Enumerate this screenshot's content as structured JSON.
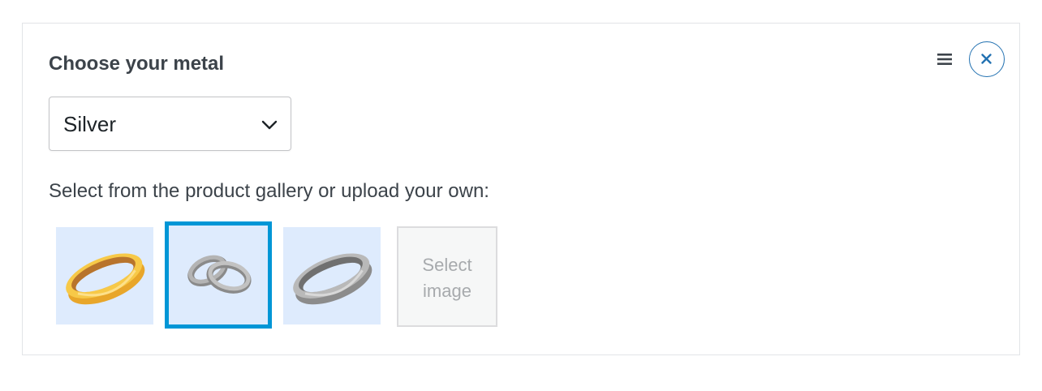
{
  "panel": {
    "title": "Choose your metal",
    "menu_icon": "hamburger-menu-icon",
    "close_icon": "close-icon",
    "accent_color": "#2271b1"
  },
  "metal_select": {
    "selected": "Silver",
    "arrow_icon": "chevron-down-icon"
  },
  "gallery": {
    "instructions": "Select from the product gallery or upload your own:",
    "images": [
      {
        "name": "gold-ring-icon",
        "selected": false
      },
      {
        "name": "interlocked-silver-rings-icon",
        "selected": true
      },
      {
        "name": "silver-ring-icon",
        "selected": false
      }
    ],
    "selected_border_color": "#0096d6",
    "select_image_label": "Select\nimage"
  }
}
